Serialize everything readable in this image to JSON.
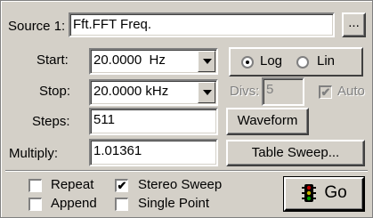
{
  "source": {
    "label": "Source 1:",
    "value": "Fft.FFT Freq.",
    "browse_label": "..."
  },
  "start": {
    "label": "Start:",
    "value": "20.0000  Hz"
  },
  "stop": {
    "label": "Stop:",
    "value": "20.0000 kHz"
  },
  "scale": {
    "log_label": "Log",
    "lin_label": "Lin",
    "selected": "Log"
  },
  "divs": {
    "label": "Divs:",
    "value": "5"
  },
  "auto": {
    "label": "Auto",
    "checked": true
  },
  "steps": {
    "label": "Steps:",
    "value": "511"
  },
  "multiply": {
    "label": "Multiply:",
    "value": "1.01361"
  },
  "buttons": {
    "waveform": "Waveform",
    "table_sweep": "Table Sweep...",
    "go": "Go"
  },
  "options": {
    "repeat": {
      "label": "Repeat",
      "checked": false
    },
    "stereo_sweep": {
      "label": "Stereo Sweep",
      "checked": true
    },
    "append": {
      "label": "Append",
      "checked": false
    },
    "single_point": {
      "label": "Single Point",
      "checked": false
    }
  }
}
